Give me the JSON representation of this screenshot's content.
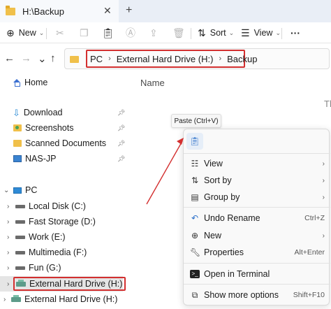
{
  "titlebar": {
    "tab_title": "H:\\Backup",
    "close_glyph": "✕",
    "add_glyph": "+"
  },
  "toolbar": {
    "new_label": "New",
    "sort_label": "Sort",
    "view_label": "View",
    "more_glyph": "···",
    "icons": [
      "new-icon",
      "cut-icon",
      "copy-icon",
      "paste-icon",
      "rename-icon",
      "share-icon",
      "delete-icon",
      "sort-icon",
      "view-icon",
      "more-icon"
    ]
  },
  "nav": {
    "back_glyph": "←",
    "forward_glyph": "→",
    "up_glyph": "↑"
  },
  "address": {
    "crumbs": [
      "PC",
      "External Hard Drive (H:)",
      "Backup"
    ],
    "sep_glyph": "›"
  },
  "sidebar": {
    "home_label": "Home",
    "quick_access": [
      {
        "label": "Download",
        "icon": "download-icon",
        "pinned": true
      },
      {
        "label": "Screenshots",
        "icon": "screenshots-folder-icon",
        "pinned": true
      },
      {
        "label": "Scanned Documents",
        "icon": "folder-icon",
        "pinned": true
      },
      {
        "label": "NAS-JP",
        "icon": "network-drive-icon",
        "pinned": true
      }
    ],
    "pc_label": "PC",
    "drives": [
      {
        "label": "Local Disk (C:)",
        "icon": "drive-icon"
      },
      {
        "label": "Fast Storage (D:)",
        "icon": "drive-icon"
      },
      {
        "label": "Work (E:)",
        "icon": "drive-icon"
      },
      {
        "label": "Multimedia (F:)",
        "icon": "drive-icon"
      },
      {
        "label": "Fun (G:)",
        "icon": "drive-icon"
      },
      {
        "label": "External Hard Drive (H:)",
        "icon": "external-drive-icon",
        "selected": true
      },
      {
        "label": "External Hard Drive (H:)",
        "icon": "external-drive-icon"
      }
    ]
  },
  "main": {
    "column_name": "Name",
    "cut_text": "Th"
  },
  "tooltip": {
    "text": "Paste (Ctrl+V)"
  },
  "context_menu": {
    "items": [
      {
        "label": "View",
        "icon": "view-icon",
        "submenu": true
      },
      {
        "label": "Sort by",
        "icon": "sort-icon",
        "submenu": true
      },
      {
        "label": "Group by",
        "icon": "group-icon",
        "submenu": true
      },
      {
        "label": "Undo Rename",
        "icon": "undo-icon",
        "shortcut": "Ctrl+Z"
      },
      {
        "label": "New",
        "icon": "new-icon",
        "submenu": true
      },
      {
        "label": "Properties",
        "icon": "properties-icon",
        "shortcut": "Alt+Enter"
      },
      {
        "label": "Open in Terminal",
        "icon": "terminal-icon"
      },
      {
        "label": "Show more options",
        "icon": "more-options-icon",
        "shortcut": "Shift+F10"
      }
    ]
  },
  "colors": {
    "highlight_red": "#d32f2f",
    "accent_blue": "#2a6fc9",
    "folder_yellow": "#f0c04a"
  }
}
